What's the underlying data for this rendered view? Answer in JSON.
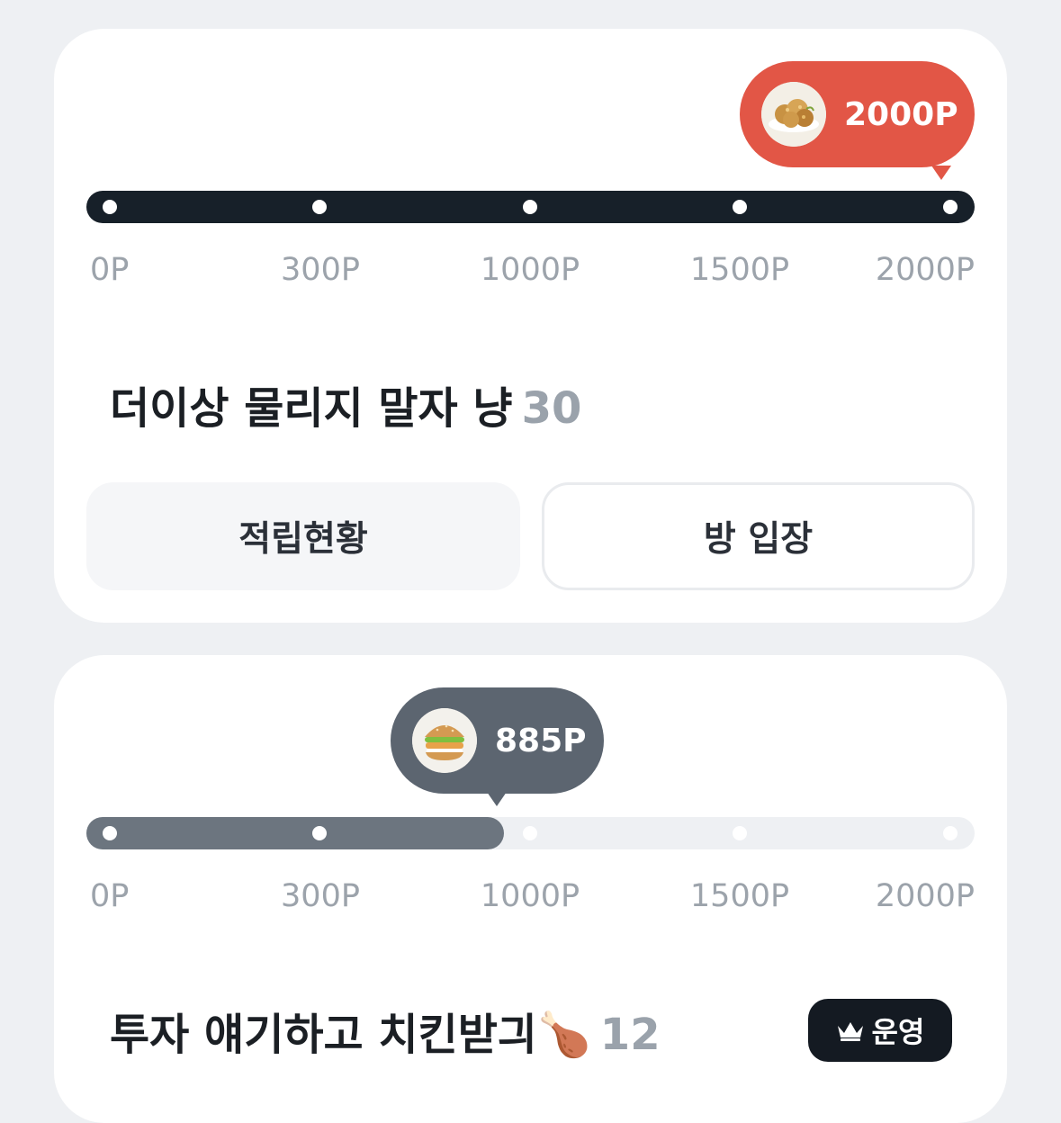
{
  "rooms": [
    {
      "reward_points": "2000P",
      "reward_item_icon": "fried-chicken",
      "progress_fraction": 1.0,
      "ticks": [
        "0P",
        "300P",
        "1000P",
        "1500P",
        "2000P"
      ],
      "title": "더이상 물리지 말자 냥",
      "member_count": "30",
      "buttons": {
        "status": "적립현황",
        "enter": "방 입장"
      },
      "colors": {
        "accent": "#e25646",
        "track": "#172029"
      }
    },
    {
      "reward_points": "885P",
      "reward_item_icon": "chicken-burger",
      "progress_fraction": 0.47,
      "ticks": [
        "0P",
        "300P",
        "1000P",
        "1500P",
        "2000P"
      ],
      "title": "투자 얘기하고 치킨받긔",
      "title_emoji": "🍗",
      "member_count": "12",
      "badge": "운영",
      "badge_icon": "crown-icon",
      "colors": {
        "accent": "#5c6570",
        "fill": "#6c757f",
        "track": "#eef0f3"
      }
    }
  ]
}
